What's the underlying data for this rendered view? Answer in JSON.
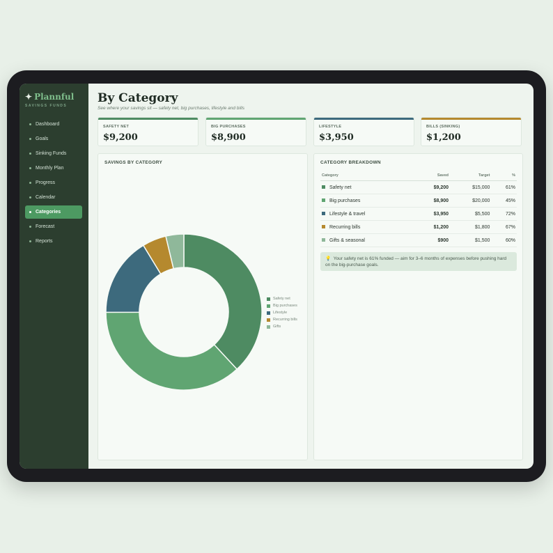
{
  "brand": {
    "name": "Plannful",
    "tagline": "SAVINGS FUNDS"
  },
  "sidebar": {
    "items": [
      {
        "label": "Dashboard",
        "active": false
      },
      {
        "label": "Goals",
        "active": false
      },
      {
        "label": "Sinking Funds",
        "active": false
      },
      {
        "label": "Monthly Plan",
        "active": false
      },
      {
        "label": "Progress",
        "active": false
      },
      {
        "label": "Calendar",
        "active": false
      },
      {
        "label": "Categories",
        "active": true
      },
      {
        "label": "Forecast",
        "active": false
      },
      {
        "label": "Reports",
        "active": false
      }
    ]
  },
  "page": {
    "title": "By Category",
    "subtitle": "See where your savings sit — safety net, big purchases, lifestyle and bills"
  },
  "stats": [
    {
      "label": "SAFETY NET",
      "value": "$9,200",
      "color": "#4e8b62"
    },
    {
      "label": "BIG PURCHASES",
      "value": "$8,900",
      "color": "#60a572"
    },
    {
      "label": "LIFESTYLE",
      "value": "$3,950",
      "color": "#3d6a7d"
    },
    {
      "label": "BILLS (SINKING)",
      "value": "$1,200",
      "color": "#b5892e"
    }
  ],
  "donut_panel": {
    "title": "SAVINGS BY CATEGORY"
  },
  "chart_data": {
    "type": "pie",
    "title": "SAVINGS BY CATEGORY",
    "categories": [
      "Safety net",
      "Big purchases",
      "Lifestyle",
      "Recurring bills",
      "Gifts"
    ],
    "values": [
      9200,
      8900,
      3950,
      1200,
      900
    ],
    "colors": [
      "#4e8b62",
      "#60a572",
      "#3d6a7d",
      "#b5892e",
      "#8fb89a"
    ],
    "legend": "right"
  },
  "breakdown": {
    "title": "CATEGORY BREAKDOWN",
    "headers": {
      "category": "Category",
      "saved": "Saved",
      "target": "Target",
      "pct": "%"
    },
    "rows": [
      {
        "name": "Safety net",
        "saved": "$9,200",
        "target": "$15,000",
        "pct": "61%",
        "color": "#4e8b62"
      },
      {
        "name": "Big purchases",
        "saved": "$8,900",
        "target": "$20,000",
        "pct": "45%",
        "color": "#60a572"
      },
      {
        "name": "Lifestyle & travel",
        "saved": "$3,950",
        "target": "$5,500",
        "pct": "72%",
        "color": "#3d6a7d"
      },
      {
        "name": "Recurring bills",
        "saved": "$1,200",
        "target": "$1,800",
        "pct": "67%",
        "color": "#b5892e"
      },
      {
        "name": "Gifts & seasonal",
        "saved": "$900",
        "target": "$1,500",
        "pct": "60%",
        "color": "#8fb89a"
      }
    ],
    "tip_icon": "lightbulb-icon",
    "tip": "Your safety net is 61% funded — aim for 3–6 months of expenses before pushing hard on the big-purchase goals."
  }
}
